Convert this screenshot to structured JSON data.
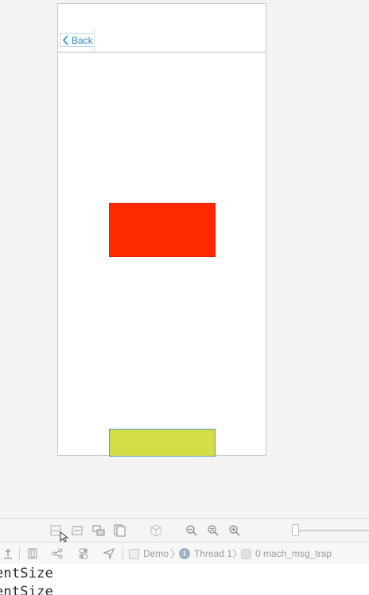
{
  "simulator": {
    "nav_bar": {
      "back_label": "Back"
    },
    "views": {
      "red_color": "#ff2a00",
      "yellow_color": "#d5dd46"
    }
  },
  "debug_toolbar": {
    "icons": [
      "view-frames-icon",
      "clipping-icon",
      "show-constraints-icon",
      "layers-icon",
      "3d-cube-icon",
      "zoom-out-icon",
      "zoom-actual-icon",
      "zoom-in-icon"
    ],
    "zoom_slider_value": 0.0
  },
  "debug_bar": {
    "breadcrumbs": {
      "app": "Demo",
      "thread": "Thread 1",
      "frame": "0 mach_msg_trap"
    }
  },
  "console": {
    "lines": [
      "entSize",
      "entSize"
    ]
  }
}
